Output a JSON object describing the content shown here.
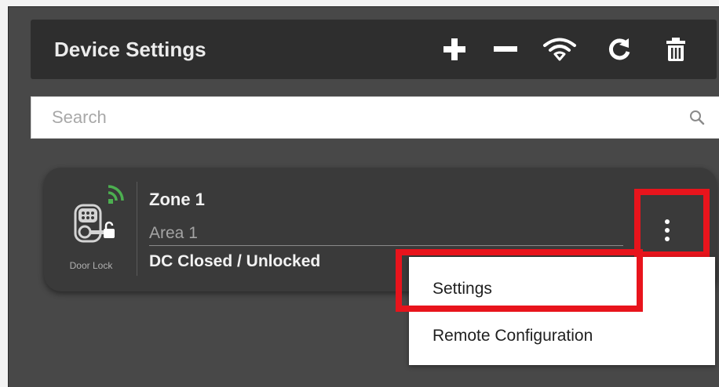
{
  "header": {
    "title": "Device Settings",
    "toolbar": [
      {
        "name": "add-button",
        "icon": "plus-icon"
      },
      {
        "name": "remove-button",
        "icon": "minus-icon"
      },
      {
        "name": "wifi-button",
        "icon": "wifi-icon"
      },
      {
        "name": "refresh-button",
        "icon": "refresh-icon"
      },
      {
        "name": "delete-button",
        "icon": "trash-icon"
      }
    ]
  },
  "search": {
    "placeholder": "Search",
    "value": "",
    "icon": "search-icon"
  },
  "device": {
    "icon": "door-lock-icon",
    "signal_icon": "signal-icon",
    "type_label": "Door Lock",
    "zone": "Zone 1",
    "area": "Area 1",
    "status": "DC Closed / Unlocked",
    "menu_icon": "kebab-menu-icon"
  },
  "context_menu": {
    "items": [
      {
        "label": "Settings",
        "highlighted": true
      },
      {
        "label": "Remote Configuration",
        "highlighted": false
      }
    ]
  },
  "colors": {
    "panel_bg": "#484848",
    "header_bg": "#2e2e2e",
    "card_bg": "#3a3a3a",
    "highlight": "#e8141c",
    "signal": "#4caf50"
  }
}
